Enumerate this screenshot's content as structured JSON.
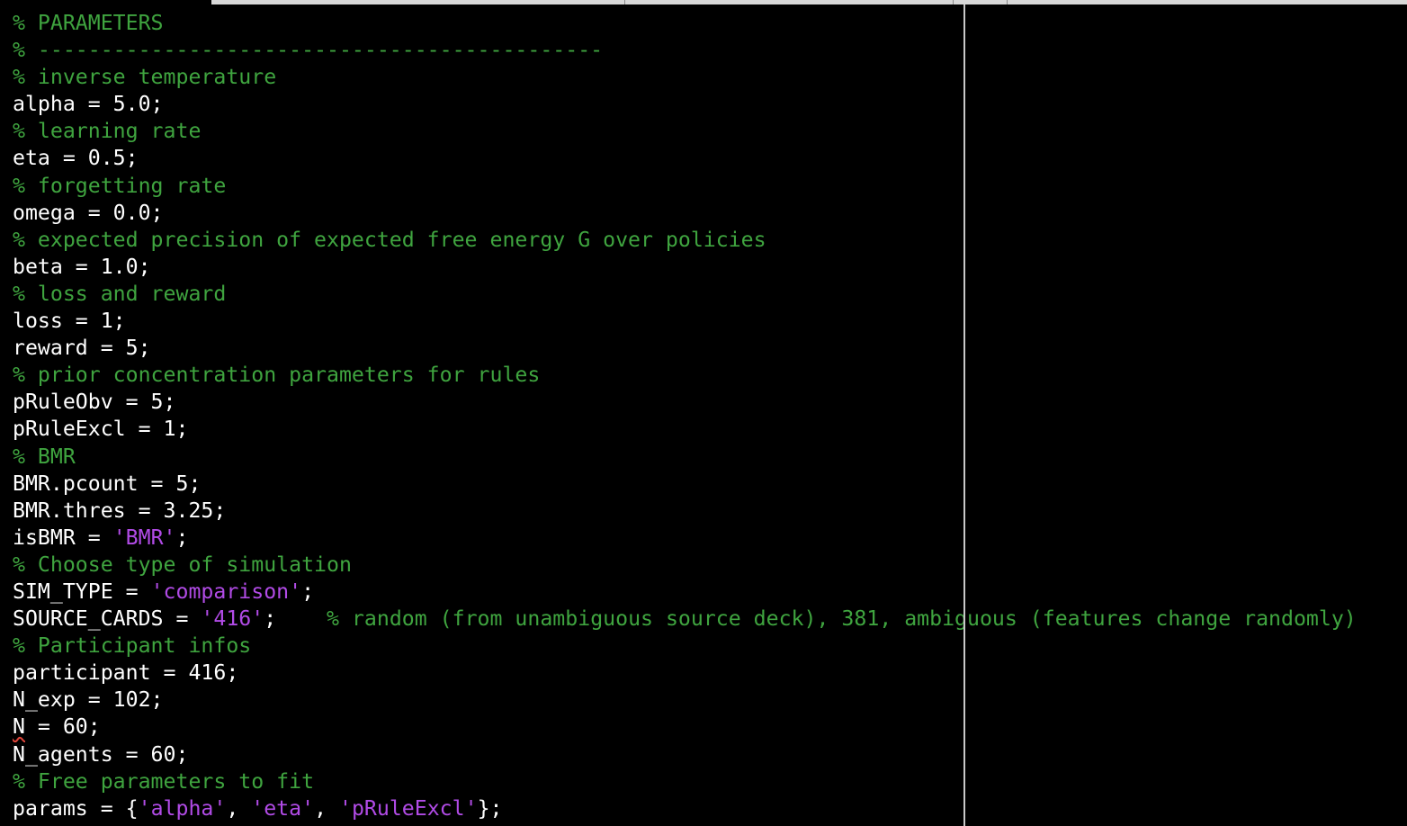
{
  "editor": {
    "lines": [
      {
        "code": "",
        "comment": "% PARAMETERS"
      },
      {
        "code": "",
        "comment": "% ---------------------------------------------"
      },
      {
        "code": "",
        "comment": "% inverse temperature"
      },
      {
        "code": "alpha = 5.0;",
        "comment": ""
      },
      {
        "code": "",
        "comment": "% learning rate"
      },
      {
        "code": "eta = 0.5;",
        "comment": ""
      },
      {
        "code": "",
        "comment": "% forgetting rate"
      },
      {
        "code": "omega = 0.0;",
        "comment": ""
      },
      {
        "code": "",
        "comment": "% expected precision of expected free energy G over policies"
      },
      {
        "code": "beta = 1.0;",
        "comment": ""
      },
      {
        "code": "",
        "comment": "% loss and reward"
      },
      {
        "code": "loss = 1;",
        "comment": ""
      },
      {
        "code": "reward = 5;",
        "comment": ""
      },
      {
        "code": "",
        "comment": "% prior concentration parameters for rules"
      },
      {
        "code": "pRuleObv = 5;",
        "comment": ""
      },
      {
        "code": "pRuleExcl = 1;",
        "comment": ""
      },
      {
        "code": "",
        "comment": "% BMR"
      },
      {
        "code": "BMR.pcount = 5;",
        "comment": ""
      },
      {
        "code": "BMR.thres = 3.25;",
        "comment": ""
      },
      {
        "code": "isBMR = 'BMR';",
        "comment": ""
      },
      {
        "code": "",
        "comment": "% Choose type of simulation"
      },
      {
        "code": "SIM_TYPE = 'comparison';",
        "comment": ""
      },
      {
        "code": "SOURCE_CARDS = '416';    ",
        "comment": "% random (from unambiguous source deck), 381, ambiguous (features change randomly)"
      },
      {
        "code": "",
        "comment": "% Participant infos"
      },
      {
        "code": "participant = 416;",
        "comment": ""
      },
      {
        "code": "N_exp = 102;",
        "comment": ""
      },
      {
        "code": "N = 60;",
        "comment": "",
        "squiggle": "N"
      },
      {
        "code": "N_agents = 60;",
        "comment": ""
      },
      {
        "code": "",
        "comment": "% Free parameters to fit"
      },
      {
        "code": "params = {'alpha', 'eta', 'pRuleExcl'};",
        "comment": ""
      }
    ]
  },
  "colors": {
    "background": "#000000",
    "text": "#ffffff",
    "comment": "#3fa43f",
    "string": "#b14be6",
    "squiggle": "#e0453a",
    "margin_line": "#c8c8c8"
  }
}
